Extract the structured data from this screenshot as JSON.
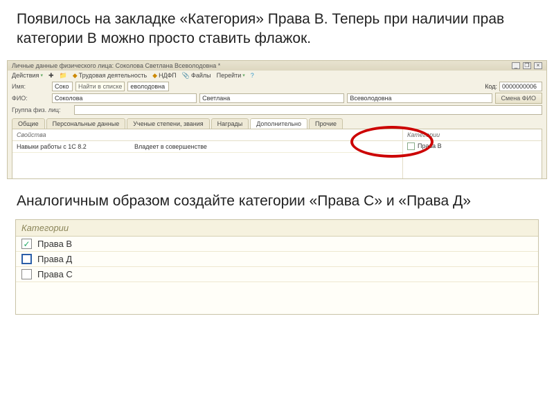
{
  "heading1": "Появилось на закладке «Категория» Права В. Теперь при наличии прав категории В можно просто ставить флажок.",
  "heading2": "Аналогичным образом создайте категории «Права С» и «Права Д»",
  "window": {
    "title": "Личные данные физического лица: Соколова Светлана Всеволодовна *",
    "toolbar": {
      "actions": "Действия",
      "trud": "Трудовая деятельность",
      "ndfp": "НДФП",
      "files": "Файлы",
      "goto": "Перейти"
    },
    "form": {
      "imya_label": "Имя:",
      "imya_val1": "Соко",
      "imya_find": "Найти в списке",
      "imya_val2": "еволодовна",
      "code_label": "Код:",
      "code_value": "0000000006",
      "fio_label": "ФИО:",
      "fio_last": "Соколова",
      "fio_first": "Светлана",
      "fio_pat": "Всеволодовна",
      "smena": "Смена ФИО",
      "group_label": "Группа физ. лиц:",
      "group_value": ""
    },
    "tabs": {
      "t0": "Общие",
      "t1": "Персональные данные",
      "t2": "Ученые степени, звания",
      "t3": "Награды",
      "t4": "Дополнительно",
      "t5": "Прочие"
    },
    "props": {
      "section": "Свойства",
      "row1_k": "Навыки работы с 1С 8.2",
      "row1_v": "Владеет в совершенстве"
    },
    "categories": {
      "section": "Категории",
      "item1": "Права В"
    }
  },
  "categories_panel": {
    "title": "Категории",
    "items": [
      {
        "label": "Права В",
        "checked": true,
        "selected": false
      },
      {
        "label": "Права Д",
        "checked": false,
        "selected": true
      },
      {
        "label": "Права С",
        "checked": false,
        "selected": false
      }
    ]
  }
}
